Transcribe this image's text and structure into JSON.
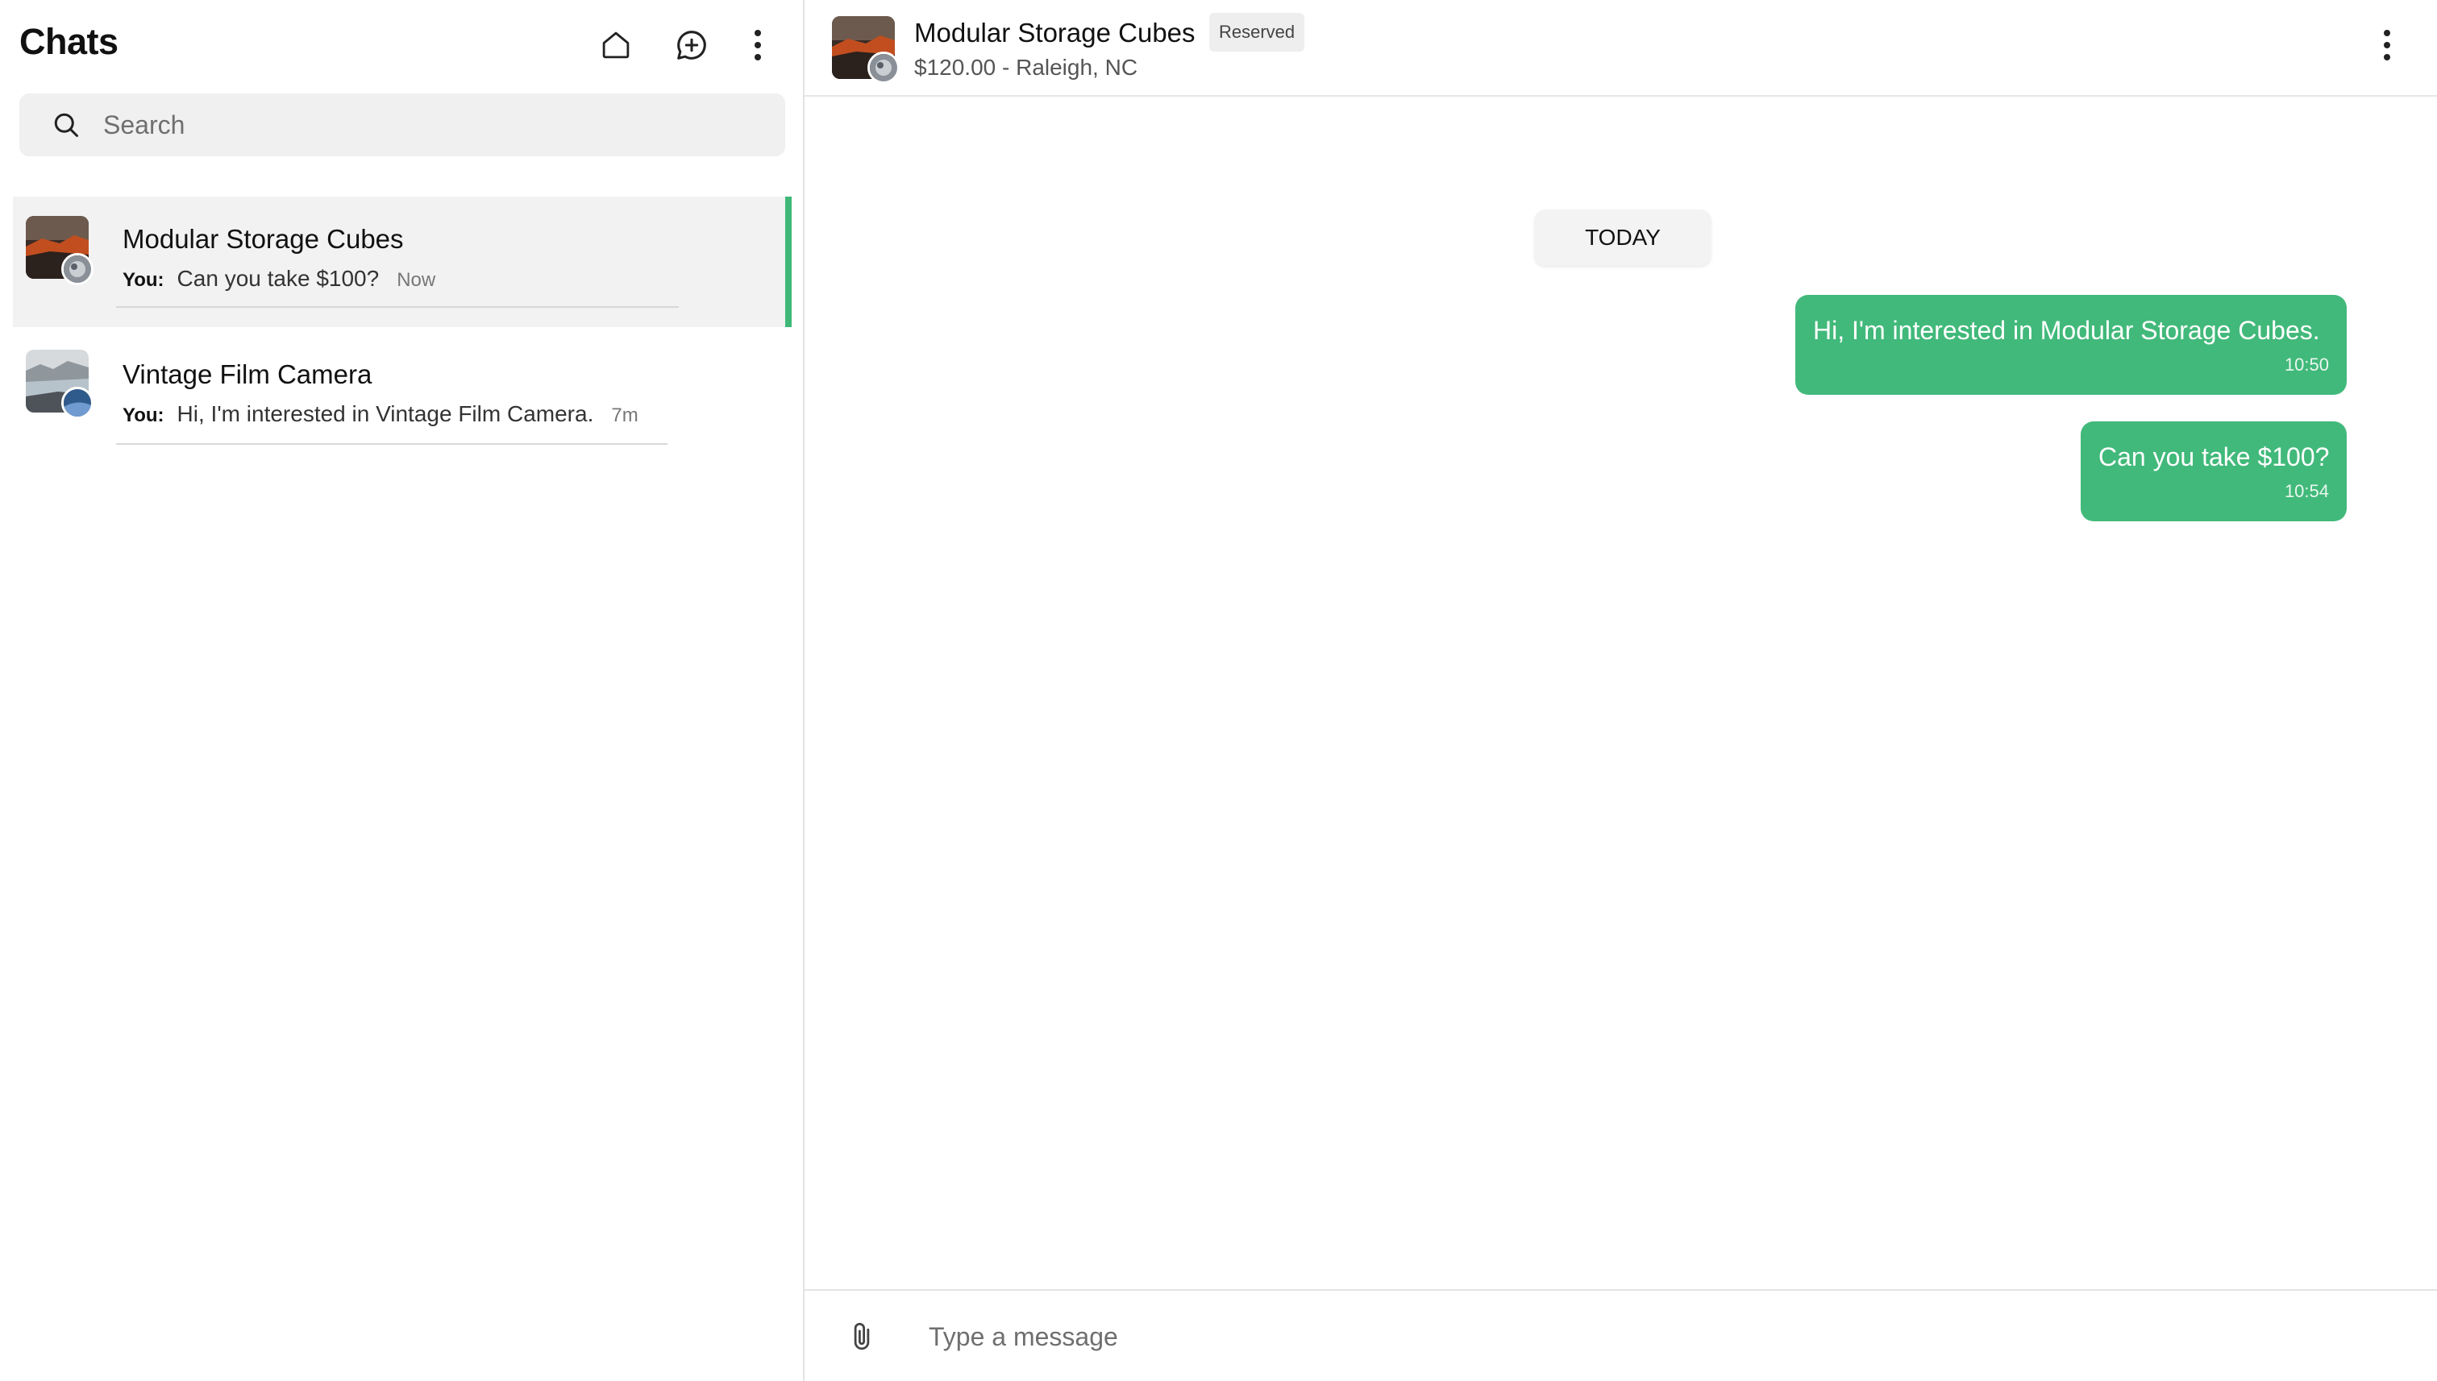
{
  "sidebar": {
    "title": "Chats",
    "icons": {
      "home": "home-icon",
      "new_chat": "new-chat-icon",
      "menu": "kebab-menu-icon"
    },
    "search": {
      "placeholder": "Search",
      "value": ""
    },
    "chats": [
      {
        "name": "Modular Storage Cubes",
        "you_label": "You:",
        "preview": "Can you take $100?",
        "time": "Now",
        "active": true
      },
      {
        "name": "Vintage Film Camera",
        "you_label": "You:",
        "preview": "Hi, I'm interested in Vintage Film Camera.",
        "time": "7m",
        "active": false
      }
    ]
  },
  "conversation": {
    "title": "Modular Storage Cubes",
    "status": "Reserved",
    "subtitle": "$120.00 - Raleigh, NC",
    "day_label": "TODAY",
    "messages": [
      {
        "text": "Hi, I'm interested in Modular Storage Cubes.",
        "time": "10:50",
        "from": "me"
      },
      {
        "text": "Can you take $100?",
        "time": "10:54",
        "from": "me"
      }
    ],
    "composer": {
      "placeholder": "Type a message",
      "value": ""
    }
  },
  "colors": {
    "accent": "#41b97a",
    "active_row": "#f2f2f2",
    "status_badge": "#eeeeee"
  }
}
